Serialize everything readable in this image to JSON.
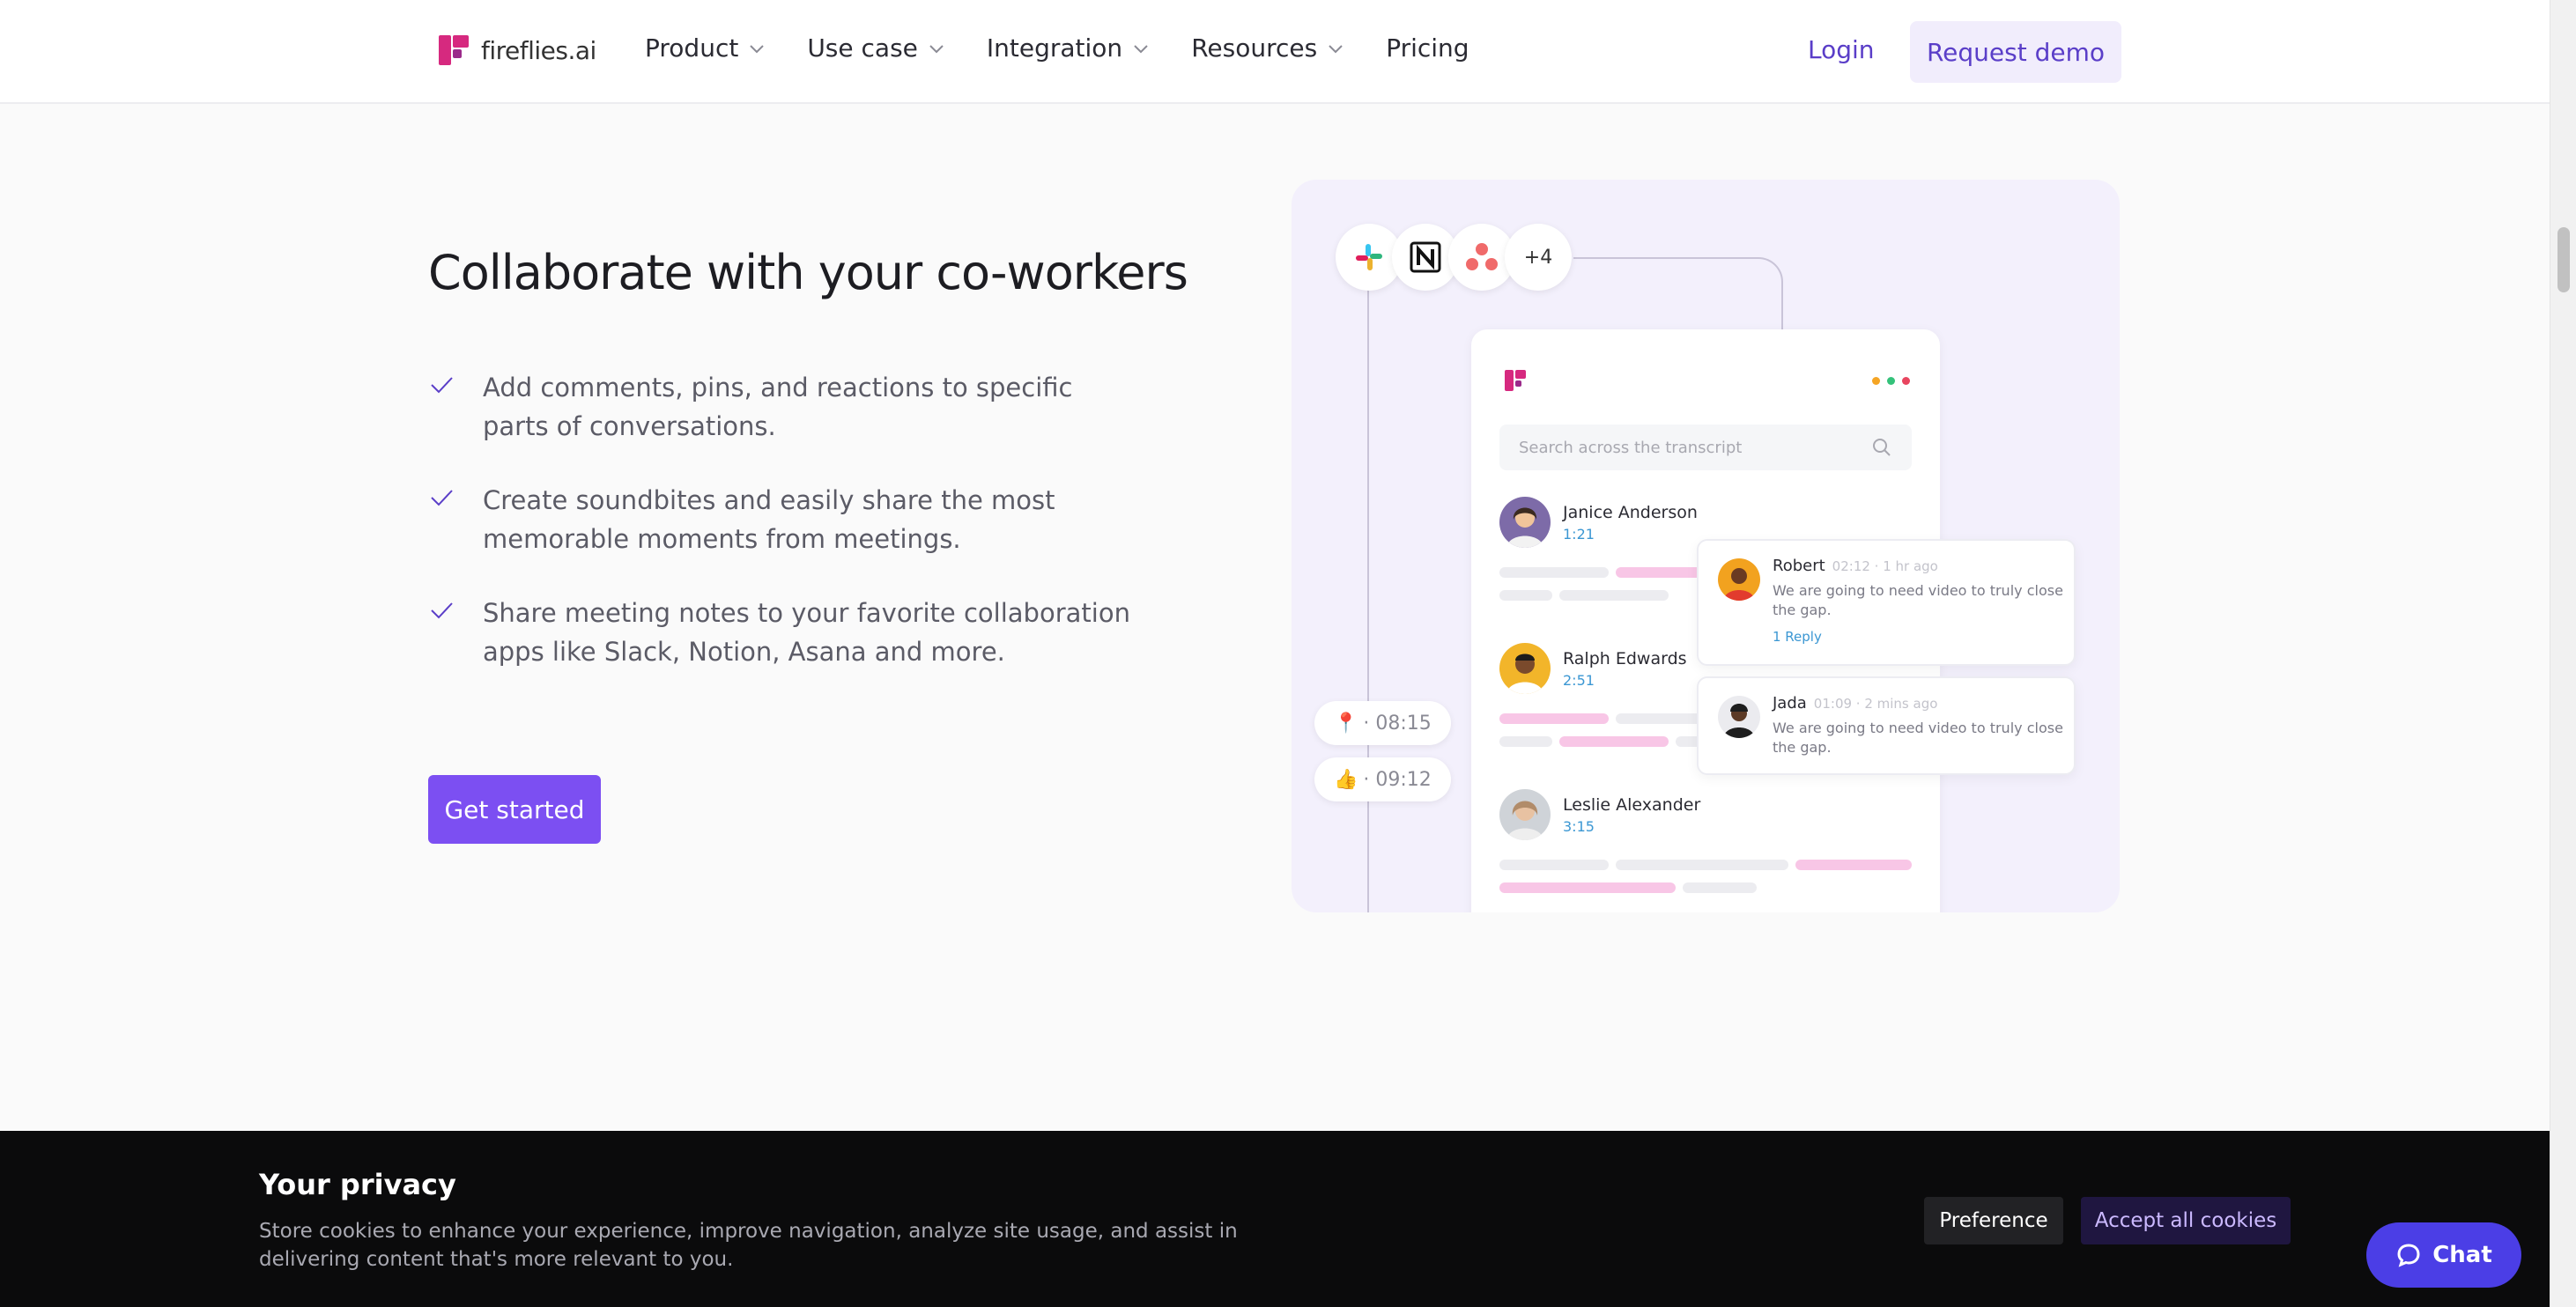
{
  "nav": {
    "logo_text": "fireflies.ai",
    "links": [
      {
        "label": "Product",
        "dropdown": true
      },
      {
        "label": "Use case",
        "dropdown": true
      },
      {
        "label": "Integration",
        "dropdown": true
      },
      {
        "label": "Resources",
        "dropdown": true
      },
      {
        "label": "Pricing",
        "dropdown": false
      }
    ],
    "login": "Login",
    "demo": "Request demo"
  },
  "hero": {
    "title": "Collaborate with your co-workers",
    "features": [
      "Add comments, pins, and reactions to specific parts of conversations.",
      "Create soundbites and easily share the most memorable moments from meetings.",
      "Share meeting notes to your favorite collaboration apps like Slack, Notion, Asana and more."
    ],
    "cta": "Get started"
  },
  "illustration": {
    "app_icons": [
      "slack-icon",
      "notion-icon",
      "asana-icon"
    ],
    "more_count": "+4",
    "search_placeholder": "Search across the transcript",
    "speakers": [
      {
        "name": "Janice Anderson",
        "time": "1:21"
      },
      {
        "name": "Ralph Edwards",
        "time": "2:51"
      },
      {
        "name": "Leslie Alexander",
        "time": "3:15"
      }
    ],
    "comments": [
      {
        "name": "Robert",
        "meta": "02:12 · 1 hr ago",
        "text": "We are going to need video to truly close the gap.",
        "reply": "1 Reply"
      },
      {
        "name": "Jada",
        "meta": "01:09 · 2 mins ago",
        "text": "We are going to need video to truly close the gap.",
        "reply": ""
      }
    ],
    "pins": [
      {
        "icon": "pin-icon",
        "glyph": "📍",
        "time": "· 08:15"
      },
      {
        "icon": "thumbs-up-icon",
        "glyph": "👍",
        "time": "· 09:12"
      }
    ],
    "colors": {
      "dot_orange": "#f5a524",
      "dot_green": "#34c27a",
      "dot_red": "#e8455f"
    }
  },
  "cookie": {
    "title": "Your privacy",
    "text": "Store cookies to enhance your experience, improve navigation, analyze site usage, and assist in delivering content that's more relevant to you.",
    "preference": "Preference",
    "accept": "Accept all cookies"
  },
  "chat": {
    "label": "Chat"
  },
  "colors": {
    "brand": "#7c4ff2",
    "accent_text": "#5a3ec8",
    "logo_pink": "#d6297f"
  }
}
